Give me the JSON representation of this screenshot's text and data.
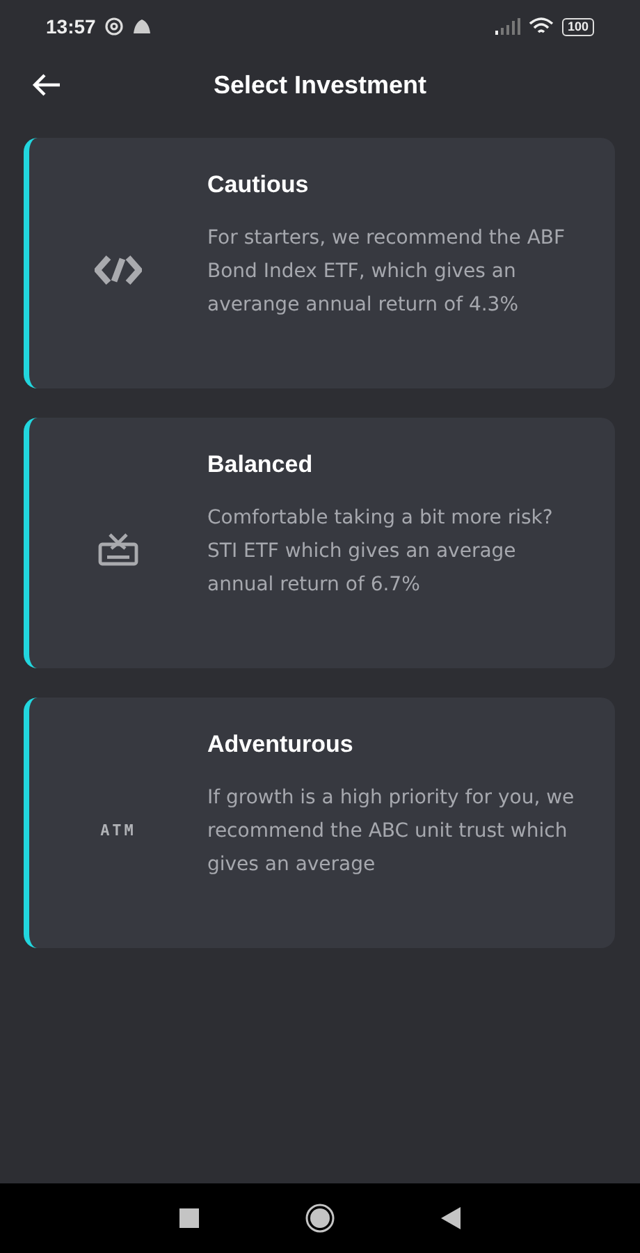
{
  "status_bar": {
    "time": "13:57",
    "battery": "100"
  },
  "header": {
    "title": "Select Investment"
  },
  "options": [
    {
      "title": "Cautious",
      "description": "For starters, we recommend the ABF Bond Index ETF, which gives an averange annual return of 4.3%",
      "icon": {
        "kind": "code"
      }
    },
    {
      "title": "Balanced",
      "description": "Comfortable taking a bit more risk? STI ETF which gives an average annual return of 6.7%",
      "icon": {
        "kind": "gift"
      }
    },
    {
      "title": "Adventurous",
      "description": "If growth is a high priority for you, we recommend the ABC unit trust which gives an average",
      "icon": {
        "kind": "text",
        "text": "ATM"
      }
    }
  ]
}
